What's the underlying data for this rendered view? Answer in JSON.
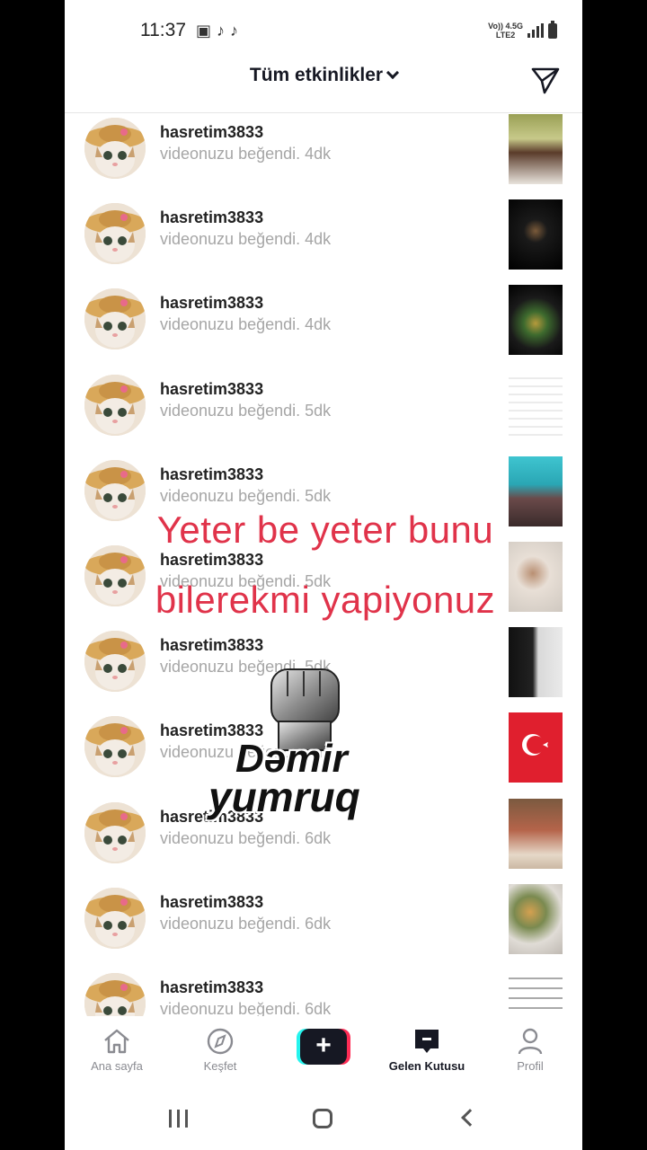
{
  "status_bar": {
    "time": "11:37",
    "network_top": "Vo)) 4.5G",
    "network_bottom": "LTE2"
  },
  "header": {
    "title": "Tüm etkinlikler"
  },
  "notifications": [
    {
      "username": "hasretim3833",
      "action": "videonuzu beğendi.",
      "time": "4dk"
    },
    {
      "username": "hasretim3833",
      "action": "videonuzu beğendi.",
      "time": "4dk"
    },
    {
      "username": "hasretim3833",
      "action": "videonuzu beğendi.",
      "time": "4dk"
    },
    {
      "username": "hasretim3833",
      "action": "videonuzu beğendi.",
      "time": "5dk"
    },
    {
      "username": "hasretim3833",
      "action": "videonuzu beğendi.",
      "time": "5dk"
    },
    {
      "username": "hasretim3833",
      "action": "videonuzu beğendi.",
      "time": "5dk"
    },
    {
      "username": "hasretim3833",
      "action": "videonuzu beğendi.",
      "time": "5dk"
    },
    {
      "username": "hasretim3833",
      "action": "videonuzu beğendi.",
      "time": "6dk"
    },
    {
      "username": "hasretim3833",
      "action": "videonuzu beğendi.",
      "time": "6dk"
    },
    {
      "username": "hasretim3833",
      "action": "videonuzu beğendi.",
      "time": "6dk"
    },
    {
      "username": "hasretim3833",
      "action": "videonuzu beğendi.",
      "time": "6dk"
    }
  ],
  "overlay": {
    "line1": "Yeter be yeter bunu",
    "line2": "bilerekmi yapiyonuz",
    "sticker_line1": "Dəmir",
    "sticker_line2": "yumruq"
  },
  "tabs": [
    {
      "label": "Ana sayfa",
      "icon": "home-icon"
    },
    {
      "label": "Keşfet",
      "icon": "compass-icon"
    },
    {
      "label": "",
      "icon": "plus-icon"
    },
    {
      "label": "Gelen Kutusu",
      "icon": "inbox-icon"
    },
    {
      "label": "Profil",
      "icon": "profile-icon"
    }
  ],
  "colors": {
    "accent_red": "#e0334a",
    "tiktok_cyan": "#25f4ee",
    "tiktok_pink": "#fe2c55",
    "text_dark": "#161823",
    "text_muted": "#a6a6a6"
  }
}
